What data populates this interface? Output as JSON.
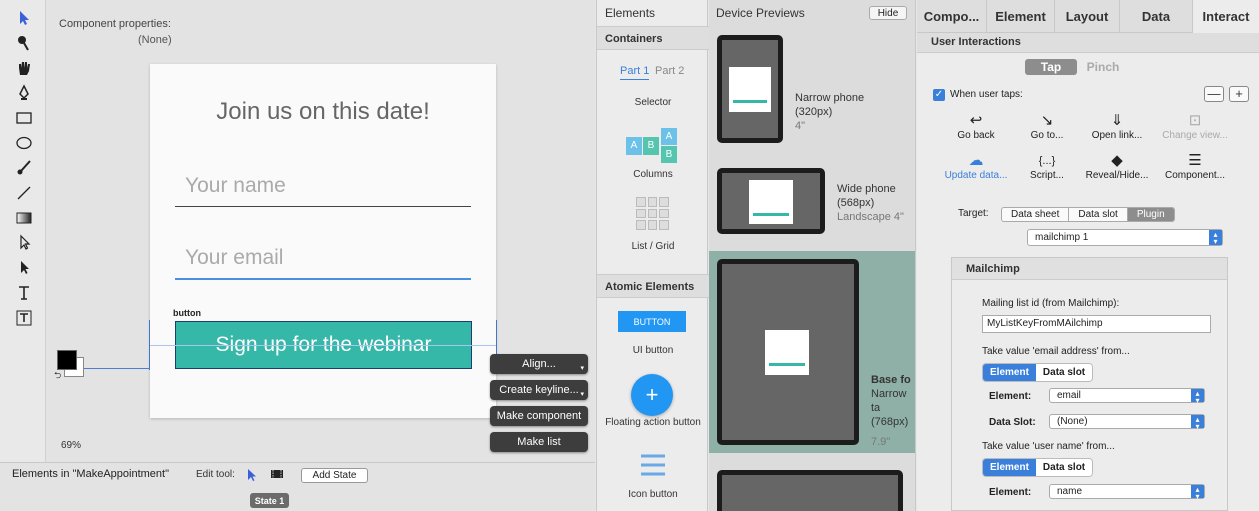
{
  "canvas": {
    "component_properties_label": "Component properties:",
    "component_properties_value": "(None)",
    "zoom": "69%",
    "artboard": {
      "title": "Join us on this date!",
      "name_placeholder": "Your name",
      "email_placeholder": "Your email",
      "button_layer_label": "button",
      "button_text": "Sign up for the webinar"
    },
    "context_buttons": [
      "Align...",
      "Create keyline...",
      "Make component",
      "Make list"
    ]
  },
  "tools": [
    "pointer-tool",
    "lasso-tool",
    "hand-tool",
    "pen-tool",
    "rectangle-tool",
    "ellipse-tool",
    "brush-tool",
    "line-tool",
    "gradient-tool",
    "direct-select-tool",
    "subselect-tool",
    "text-tool",
    "text-box-tool"
  ],
  "bottom_bar": {
    "title": "Elements in \"MakeAppointment\"",
    "edit_tool_label": "Edit tool:",
    "add_state": "Add State",
    "state": "State 1"
  },
  "elements_panel": {
    "header": "Elements",
    "containers_section": "Containers",
    "tabs": [
      "Part 1",
      "Part 2"
    ],
    "container_items": [
      "Selector",
      "Columns",
      "List / Grid"
    ],
    "atomic_section": "Atomic Elements",
    "atomic_items": [
      "UI button",
      "Floating action button",
      "Icon button"
    ],
    "ui_button_sample": "BUTTON"
  },
  "device_previews": {
    "header": "Device Previews",
    "hide_button": "Hide",
    "devices": [
      {
        "name": "Narrow phone",
        "size": "(320px)",
        "sub": "4\""
      },
      {
        "name": "Wide phone",
        "size": "(568px)",
        "sub": "Landscape 4\""
      },
      {
        "name": "Base fo",
        "size": "Narrow ta",
        "sub": "(768px)",
        "sub2": "7.9\""
      }
    ]
  },
  "inspector": {
    "tabs": [
      "Compo...",
      "Element",
      "Layout",
      "Data",
      "Interact"
    ],
    "active_tab": "Interact",
    "section": "User Interactions",
    "gesture_tabs": [
      "Tap",
      "Pinch"
    ],
    "when_user_taps": "When user taps:",
    "minus": "—",
    "plus": "+",
    "actions": [
      {
        "label": "Go back",
        "icon": "↩"
      },
      {
        "label": "Go to...",
        "icon": "↘"
      },
      {
        "label": "Open link...",
        "icon": "⇓"
      },
      {
        "label": "Change view...",
        "icon": "⊡"
      },
      {
        "label": "Update data...",
        "icon": "☁"
      },
      {
        "label": "Script...",
        "icon": "{...}"
      },
      {
        "label": "Reveal/Hide...",
        "icon": "◆"
      },
      {
        "label": "Component...",
        "icon": "☰"
      }
    ],
    "target_label": "Target:",
    "target_options": [
      "Data sheet",
      "Data slot",
      "Plugin"
    ],
    "plugin_value": "mailchimp 1",
    "mailchimp": {
      "title": "Mailchimp",
      "list_id_label": "Mailing list id (from Mailchimp):",
      "list_id_value": "MyListKeyFromMAilchimp",
      "email_from_label": "Take value 'email address' from...",
      "source_options": [
        "Element",
        "Data slot"
      ],
      "element_label": "Element:",
      "element_value": "email",
      "data_slot_label": "Data Slot:",
      "data_slot_value": "(None)",
      "username_from_label": "Take value 'user name' from...",
      "element2_label": "Element:",
      "element2_value": "name"
    }
  },
  "colors": {
    "accent_blue": "#3a7fd9",
    "teal_button": "#35b8a8",
    "fab_blue": "#2196f3"
  }
}
